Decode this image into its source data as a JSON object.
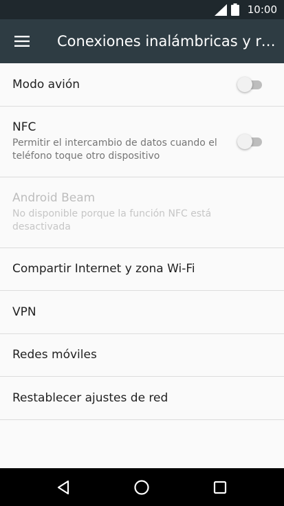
{
  "status_bar": {
    "time": "10:00"
  },
  "app_bar": {
    "title": "Conexiones inalámbricas y re..."
  },
  "settings": {
    "airplane": {
      "title": "Modo avión",
      "enabled": false
    },
    "nfc": {
      "title": "NFC",
      "summary": "Permitir el intercambio de datos cuando el teléfono toque otro dispositivo",
      "enabled": false
    },
    "android_beam": {
      "title": "Android Beam",
      "summary": "No disponible porque la función NFC está desactivada",
      "disabled": true
    },
    "tethering": {
      "title": "Compartir Internet y zona Wi-Fi"
    },
    "vpn": {
      "title": "VPN"
    },
    "mobile_networks": {
      "title": "Redes móviles"
    },
    "reset_network": {
      "title": "Restablecer ajustes de red"
    }
  },
  "colors": {
    "status_bar": "#1f282d",
    "app_bar": "#2e3c43",
    "background": "#fafafa",
    "nav_bar": "#000000"
  },
  "icons": {
    "menu": "hamburger-menu-icon",
    "signal": "signal-icon",
    "battery": "battery-icon",
    "back": "back-triangle-icon",
    "home": "home-circle-icon",
    "recents": "recents-square-icon"
  }
}
